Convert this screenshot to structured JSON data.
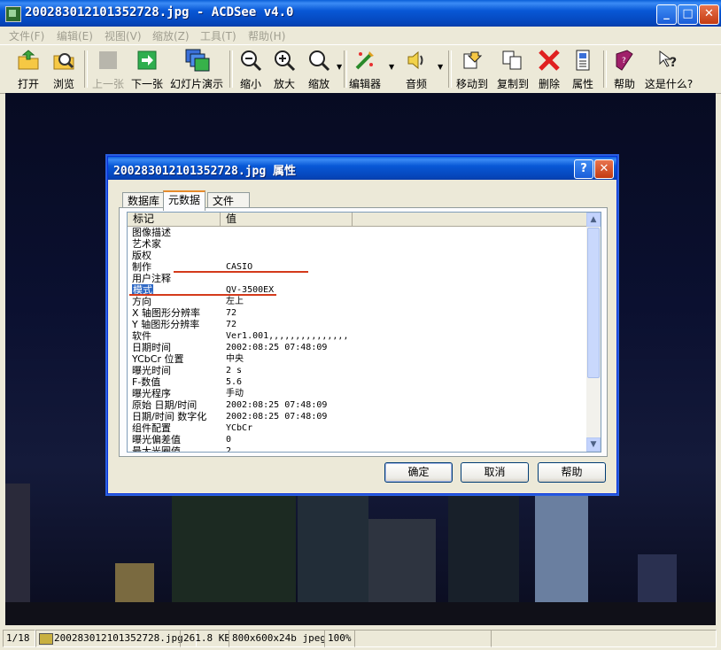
{
  "window": {
    "title": "200283012101352728.jpg - ACDSee v4.0"
  },
  "menu": [
    "文件(F)",
    "编辑(E)",
    "视图(V)",
    "缩放(Z)",
    "工具(T)",
    "帮助(H)"
  ],
  "toolbar": {
    "open": "打开",
    "browse": "浏览",
    "prev": "上一张",
    "next": "下一张",
    "slideshow": "幻灯片演示",
    "zoom_out": "缩小",
    "zoom_in": "放大",
    "zoom": "缩放",
    "editor": "编辑器",
    "audio": "音频",
    "move_to": "移动到",
    "copy_to": "复制到",
    "delete": "删除",
    "properties": "属性",
    "help": "帮助",
    "whats_this": "这是什么?"
  },
  "dialog": {
    "title": "200283012101352728.jpg 属性",
    "tabs": [
      "数据库",
      "元数据",
      "文件"
    ],
    "columns": {
      "tag": "标记",
      "value": "值"
    },
    "rows": [
      {
        "k": "图像描述",
        "v": ""
      },
      {
        "k": "艺术家",
        "v": ""
      },
      {
        "k": "版权",
        "v": ""
      },
      {
        "k": "制作",
        "v": "CASIO"
      },
      {
        "k": "用户注释",
        "v": ""
      },
      {
        "k": "模式",
        "v": "QV-3500EX"
      },
      {
        "k": "方向",
        "v": "左上"
      },
      {
        "k": "X 轴图形分辨率",
        "v": "72"
      },
      {
        "k": "Y 轴图形分辨率",
        "v": "72"
      },
      {
        "k": "软件",
        "v": "Ver1.001,,,,,,,,,,,,,,,"
      },
      {
        "k": "日期时间",
        "v": "2002:08:25 07:48:09"
      },
      {
        "k": "YCbCr 位置",
        "v": "中央"
      },
      {
        "k": "曝光时间",
        "v": "2 s"
      },
      {
        "k": "F-数值",
        "v": "5.6"
      },
      {
        "k": "曝光程序",
        "v": "手动"
      },
      {
        "k": "原始 日期/时间",
        "v": "2002:08:25 07:48:09"
      },
      {
        "k": "日期/时间 数字化",
        "v": "2002:08:25 07:48:09"
      },
      {
        "k": "组件配置",
        "v": "YCbCr"
      },
      {
        "k": "曝光偏差值",
        "v": "0"
      },
      {
        "k": "最大光圈值",
        "v": "2"
      }
    ],
    "ok": "确定",
    "cancel": "取消",
    "help": "帮助"
  },
  "status": {
    "position": "1/18",
    "filename": "200283012101352728.jpg",
    "size": "261.8 KB",
    "dims": "800x600x24b jpeg",
    "zoom": "100%"
  }
}
